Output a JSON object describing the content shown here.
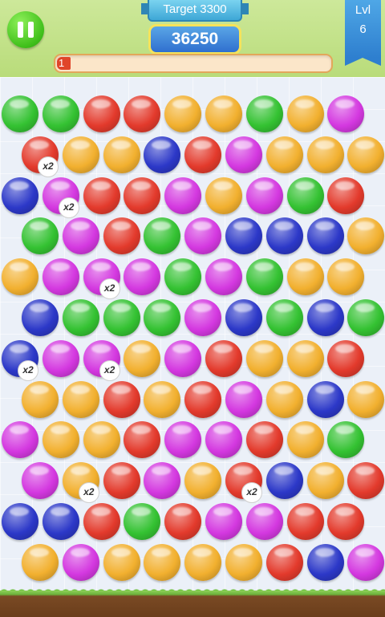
{
  "header": {
    "target_label": "Target 3300",
    "score": "36250",
    "progress_label": "1",
    "progress_fraction": 0.05,
    "level_title": "Lvl",
    "level_number": "6"
  },
  "colors": {
    "G": "#34c232",
    "R": "#e33a2c",
    "Y": "#f2b02f",
    "P": "#d438e0",
    "B": "#2c38c8"
  },
  "multiplier_text": "x2",
  "board": {
    "rows": [
      "GGRRYYGYP",
      "RYYBRPYYY",
      "BPRRPYPGR",
      "GPRGPBBBY",
      "YPPPGPGYY",
      "BGGGPBGBG",
      "BPPYPRYYR",
      "YYRYRPYBY",
      "PYYRPPRYG",
      "PYRPYRBYR",
      "BBRGRPPRR",
      "YPYYYYRBP"
    ],
    "multipliers": [
      {
        "row": 1,
        "col": 0
      },
      {
        "row": 2,
        "col": 1
      },
      {
        "row": 4,
        "col": 2
      },
      {
        "row": 6,
        "col": 0
      },
      {
        "row": 6,
        "col": 2
      },
      {
        "row": 9,
        "col": 1
      },
      {
        "row": 9,
        "col": 5
      }
    ]
  }
}
